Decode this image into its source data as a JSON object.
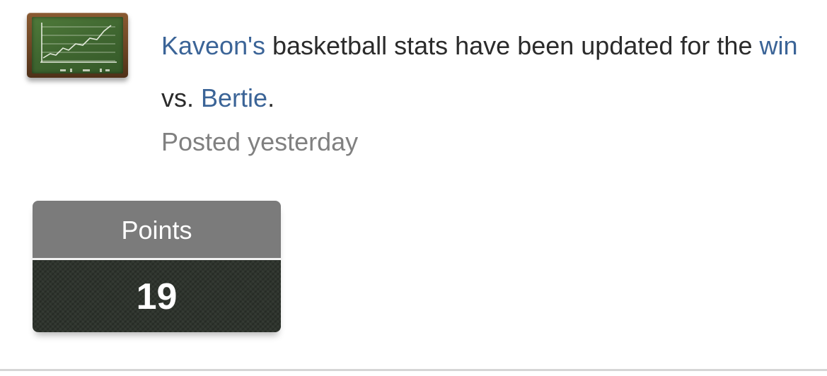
{
  "feed_item": {
    "player_name": "Kaveon's",
    "text_middle": " basketball stats have been updated for the ",
    "result_link": "win",
    "text_vs": " vs. ",
    "opponent": "Bertie",
    "text_end": ".",
    "posted": "Posted yesterday",
    "icon": "chalkboard-chart-icon"
  },
  "stat": {
    "label": "Points",
    "value": "19"
  },
  "colors": {
    "link": "#3b6497",
    "body_text": "#2b2b2b",
    "muted_text": "#808080",
    "stat_label_bg": "#7b7b7b",
    "stat_value_bg": "#2e342d"
  }
}
